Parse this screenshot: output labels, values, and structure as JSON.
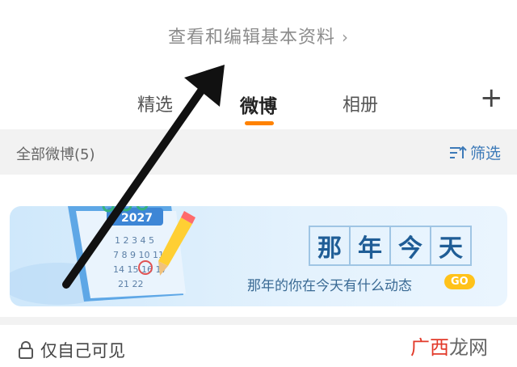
{
  "header": {
    "edit_profile": "查看和编辑基本资料"
  },
  "tabs": [
    {
      "label": "精选"
    },
    {
      "label": "微博"
    },
    {
      "label": "相册"
    }
  ],
  "filter_bar": {
    "count_label": "全部微博(5)",
    "filter_label": "筛选"
  },
  "banner": {
    "title_chars": [
      "那",
      "年",
      "今",
      "天"
    ],
    "subtitle": "那年的你在今天有什么动态",
    "go_label": "GO",
    "calendar_year": "2027"
  },
  "footer": {
    "privacy": "仅自己可见"
  },
  "watermark": {
    "part1": "广西",
    "part2": "龙网"
  },
  "colors": {
    "accent": "#ff8200",
    "link": "#3d7ab8",
    "banner_title": "#1f5d96"
  }
}
